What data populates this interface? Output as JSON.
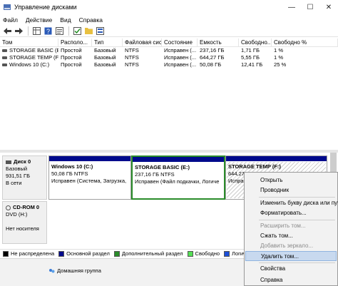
{
  "window": {
    "title": "Управление дисками",
    "controls": [
      "—",
      "☐",
      "✕"
    ]
  },
  "menu": [
    "Файл",
    "Действие",
    "Вид",
    "Справка"
  ],
  "toolbar": {
    "icons": [
      "back-icon",
      "forward-icon",
      "grid-icon",
      "help-icon",
      "properties-icon",
      "checklist-icon",
      "folder-icon",
      "disk-list-icon"
    ]
  },
  "volumes": {
    "columns": [
      "Том",
      "Располо...",
      "Тип",
      "Файловая сист...",
      "Состояние",
      "Емкость",
      "Свободно...",
      "Свободно %"
    ],
    "rows": [
      [
        "STORAGE BASIC (E:)",
        "Простой",
        "Базовый",
        "NTFS",
        "Исправен (...",
        "237,16 ГБ",
        "1,71 ГБ",
        "1 %"
      ],
      [
        "STORAGE TEMP (F:)",
        "Простой",
        "Базовый",
        "NTFS",
        "Исправен (...",
        "644,27 ГБ",
        "5,55 ГБ",
        "1 %"
      ],
      [
        "Windows 10 (C:)",
        "Простой",
        "Базовый",
        "NTFS",
        "Исправен (...",
        "50,08 ГБ",
        "12,41 ГБ",
        "25 %"
      ]
    ]
  },
  "disks": [
    {
      "name": "Диск 0",
      "type": "Базовый",
      "size": "931,51 ГБ",
      "state": "В сети",
      "partitions": [
        {
          "name": "Windows 10 (C:)",
          "size": "50,08 ГБ NTFS",
          "status": "Исправен (Система, Загрузка,"
        },
        {
          "name": "STORAGE BASIC (E:)",
          "size": "237,16 ГБ NTFS",
          "status": "Исправен (Файл подкачки, Логиче"
        },
        {
          "name": "STORAGE TEMP (F:)",
          "size": "644,27 ГБ NTFS",
          "status": "Исправен (Логический"
        }
      ]
    },
    {
      "name": "CD-ROM 0",
      "type": "DVD (H:)",
      "size": "",
      "state": "Нет носителя"
    }
  ],
  "legend": [
    {
      "label": "Не распределена",
      "color": "#000000"
    },
    {
      "label": "Основной раздел",
      "color": "#000a8c"
    },
    {
      "label": "Дополнительный раздел",
      "color": "#2a8c2a"
    },
    {
      "label": "Свободно",
      "color": "#55e055"
    },
    {
      "label": "Логичес",
      "color": "#1d4fd8"
    }
  ],
  "context_menu": [
    {
      "label": "Открыть",
      "disabled": false
    },
    {
      "label": "Проводник",
      "disabled": false
    },
    {
      "label": "Изменить букву диска или путь",
      "disabled": false
    },
    {
      "label": "Форматировать...",
      "disabled": false
    },
    {
      "label": "Расширить том...",
      "disabled": true
    },
    {
      "label": "Сжать том...",
      "disabled": false
    },
    {
      "label": "Добавить зеркало...",
      "disabled": true
    },
    {
      "label": "Удалить том...",
      "disabled": false,
      "highlighted": true
    },
    {
      "label": "Свойства",
      "disabled": false
    },
    {
      "label": "Справка",
      "disabled": false
    }
  ],
  "background": {
    "home_group": "Домашняя группа"
  }
}
